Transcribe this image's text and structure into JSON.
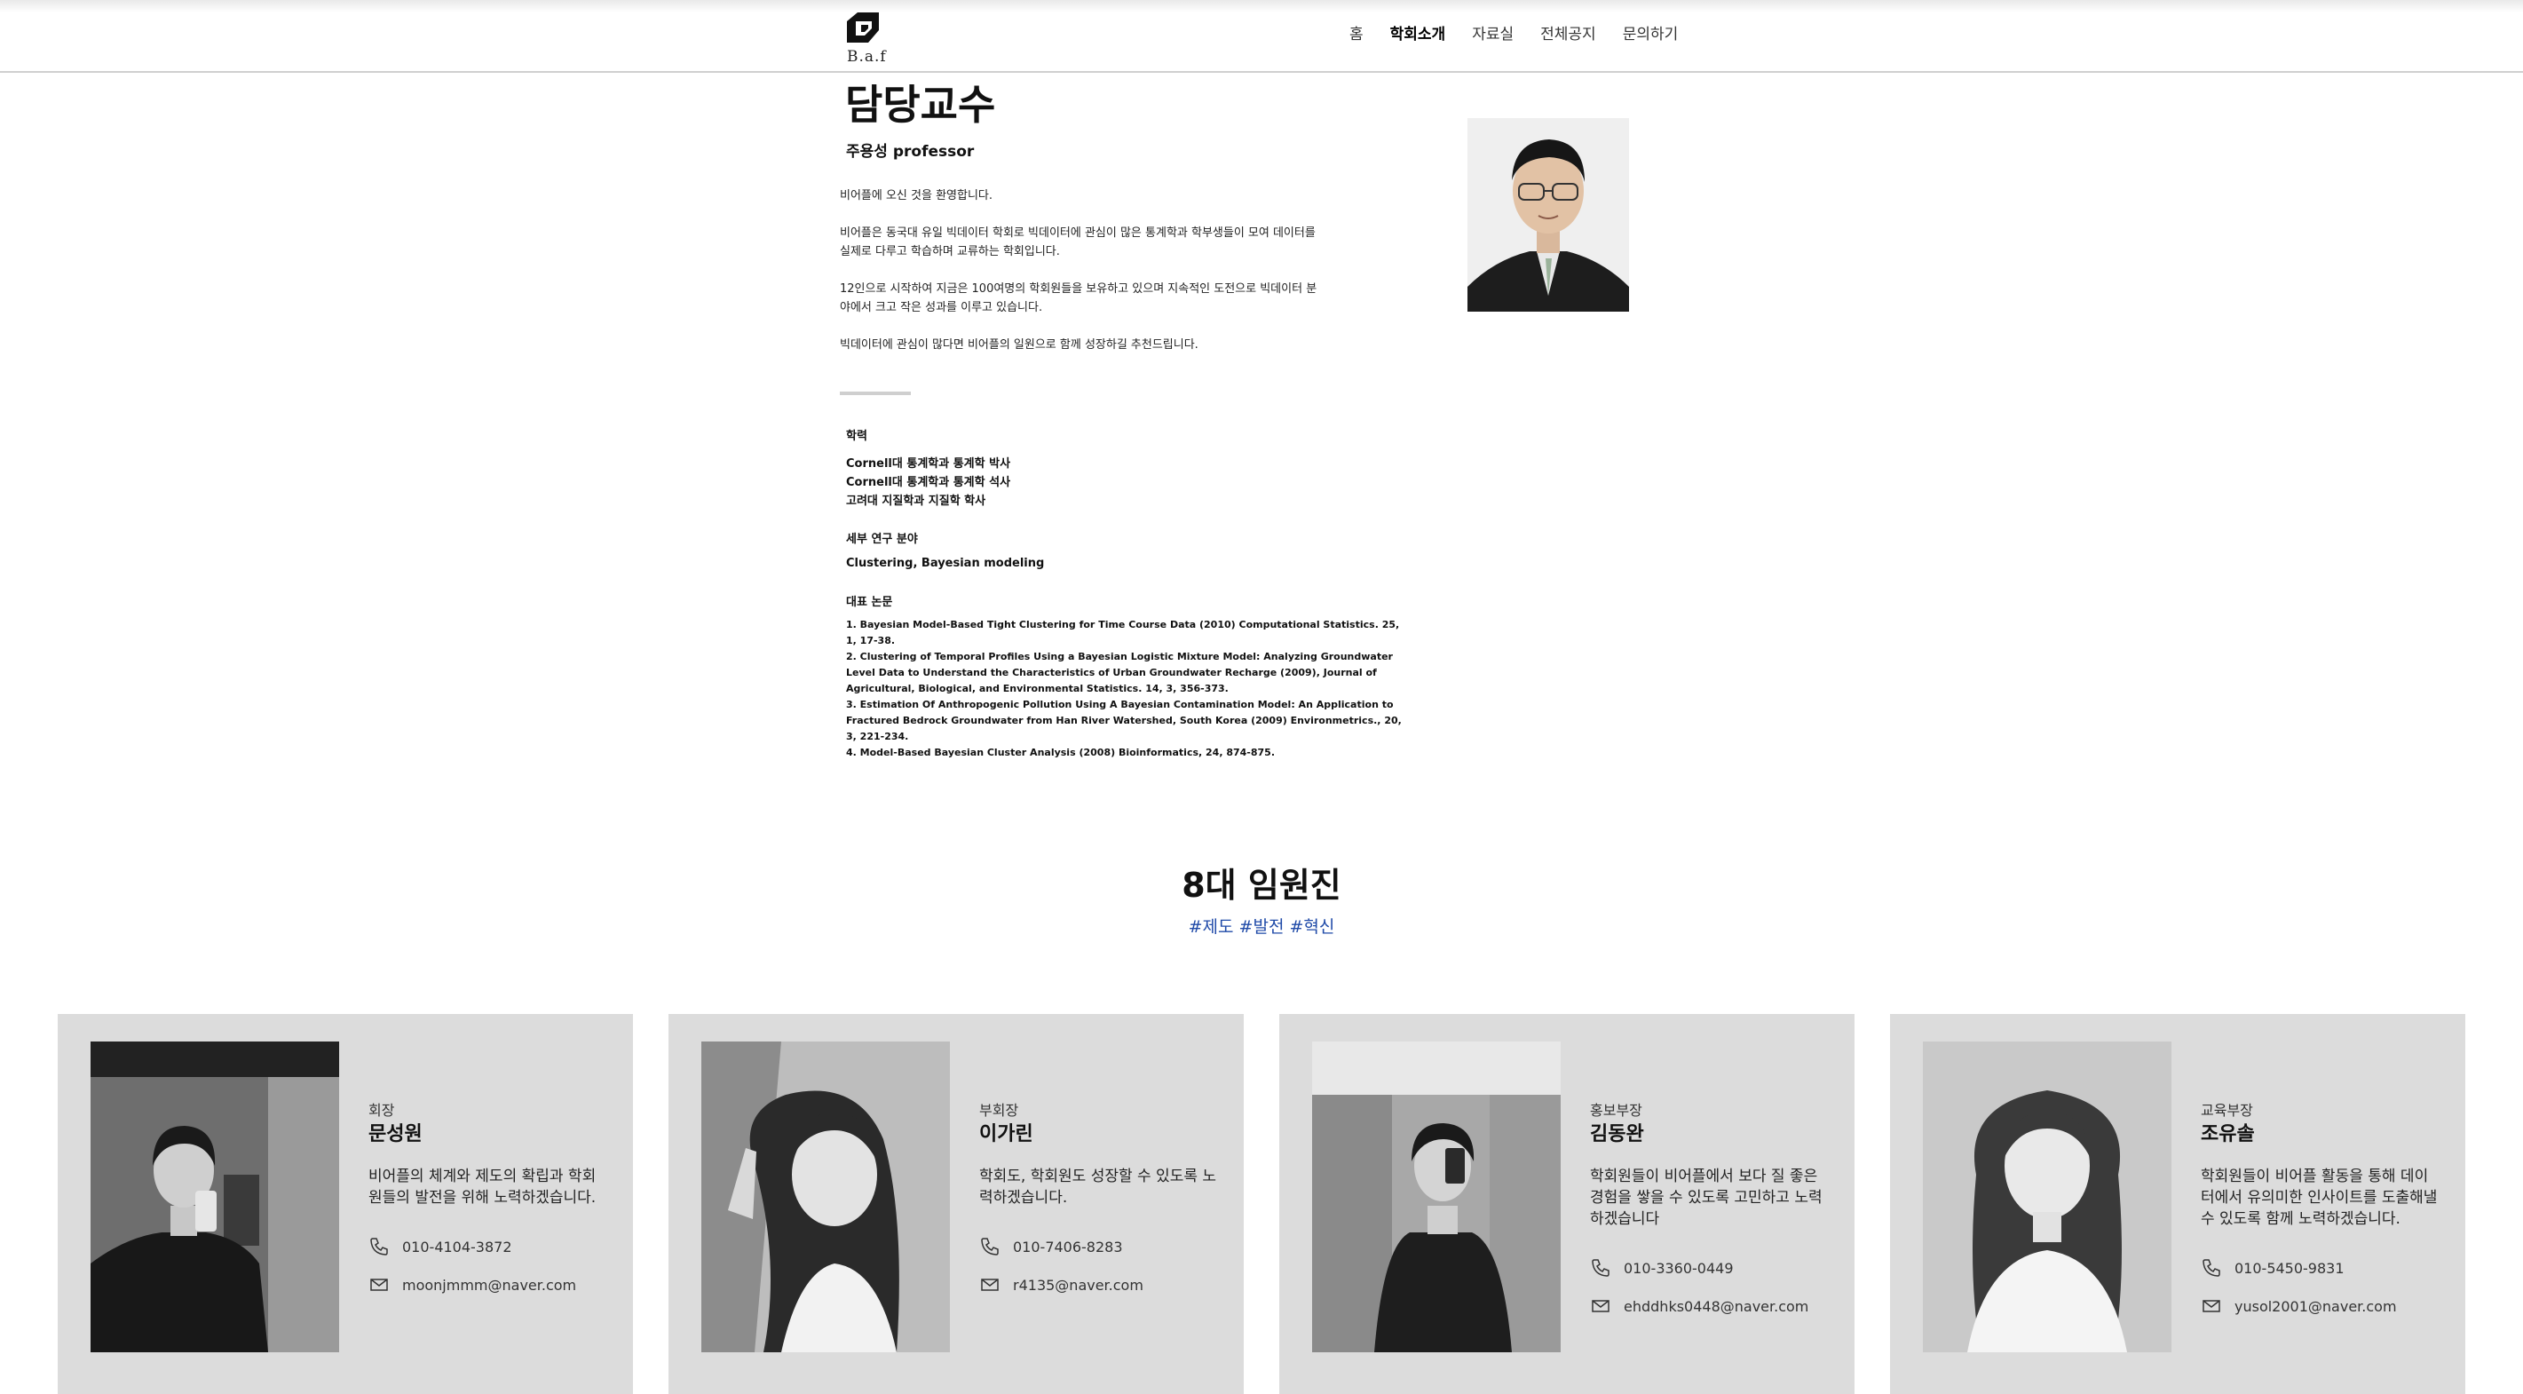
{
  "header": {
    "logo_text": "B.a.f",
    "nav": [
      "홈",
      "학회소개",
      "자료실",
      "전체공지",
      "문의하기"
    ],
    "active_nav": "학회소개"
  },
  "professor": {
    "title": "담당교수",
    "name": "주용성 professor",
    "intro": [
      "비어플에 오신 것을 환영합니다.",
      "비어플은 동국대 유일 빅데이터 학회로 빅데이터에 관심이 많은 통계학과 학부생들이 모여 데이터를 실제로 다루고 학습하며 교류하는 학회입니다.",
      "12인으로 시작하여 지금은 100여명의 학회원들을 보유하고 있으며 지속적인 도전으로 빅데이터 분야에서 크고 작은 성과를 이루고 있습니다.",
      "빅데이터에 관심이 많다면 비어플의 일원으로 함께 성장하길 추천드립니다."
    ],
    "education_label": "학력",
    "education": [
      "Cornell대 통계학과 통계학 박사",
      "Cornell대 통계학과 통계학 석사",
      "고려대 지질학과 지질학 학사"
    ],
    "research_label": "세부 연구 분야",
    "research": "Clustering, Bayesian modeling",
    "papers_label": "대표 논문",
    "papers": [
      "1. Bayesian Model-Based Tight Clustering for Time Course Data (2010) Computational Statistics. 25, 1, 17-38.",
      "2. Clustering of Temporal Profiles Using a Bayesian Logistic Mixture Model: Analyzing Groundwater Level Data to Understand the Characteristics of Urban Groundwater Recharge (2009), Journal of Agricultural, Biological, and Environmental Statistics. 14, 3, 356-373.",
      "3. Estimation Of Anthropogenic Pollution Using A Bayesian Contamination Model: An Application to Fractured Bedrock Groundwater from Han River Watershed, South Korea (2009) Environmetrics., 20, 3, 221-234.",
      "4. Model-Based Bayesian Cluster Analysis (2008) Bioinformatics, 24, 874-875."
    ]
  },
  "officers": {
    "title": "8대 임원진",
    "tags": "#제도 #발전 #혁신",
    "members": [
      {
        "role": "회장",
        "name": "문성원",
        "desc": "비어플의 체계와 제도의 확립과 학회원들의 발전을 위해 노력하겠습니다.",
        "phone": "010-4104-3872",
        "email": "moonjmmm@naver.com"
      },
      {
        "role": "부회장",
        "name": "이가린",
        "desc": "학회도, 학회원도 성장할 수 있도록 노력하겠습니다.",
        "phone": "010-7406-8283",
        "email": "r4135@naver.com"
      },
      {
        "role": "홍보부장",
        "name": "김동완",
        "desc": "학회원들이 비어플에서 보다 질 좋은 경험을 쌓을 수 있도록 고민하고 노력하겠습니다",
        "phone": "010-3360-0449",
        "email": "ehddhks0448@naver.com"
      },
      {
        "role": "교육부장",
        "name": "조유솔",
        "desc": "학회원들이 비어플 활동을 통해 데이터에서 유의미한 인사이트를 도출해낼 수 있도록 함께 노력하겠습니다.",
        "phone": "010-5450-9831",
        "email": "yusol2001@naver.com"
      }
    ]
  },
  "icons": {
    "logo": "baf-logo-icon",
    "phone": "phone-icon",
    "email": "mail-icon"
  },
  "colors": {
    "accent_tags": "#1f4aa8",
    "card_bg": "#dcdcdc"
  }
}
